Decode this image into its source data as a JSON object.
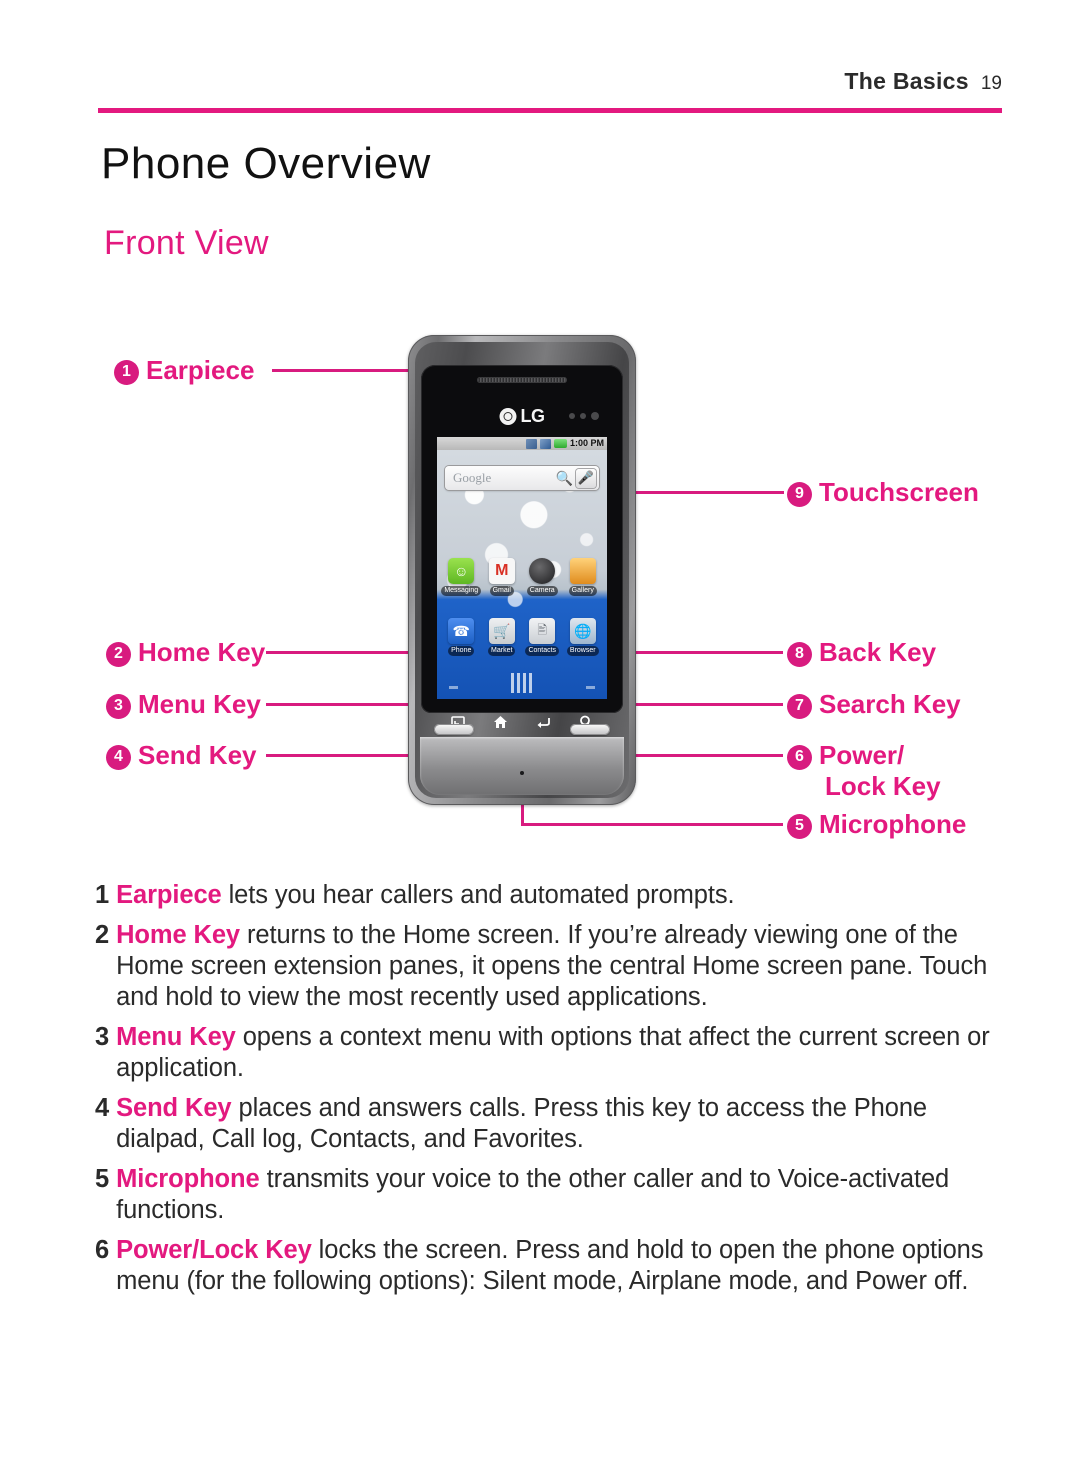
{
  "header": {
    "title": "The Basics",
    "page_number": "19",
    "rule_color": "#e3197f"
  },
  "titles": {
    "doc_title": "Phone Overview",
    "section_title": "Front View"
  },
  "callouts": [
    {
      "id": "earpiece",
      "number": "1",
      "label": "Earpiece",
      "label_line2": ""
    },
    {
      "id": "home-key",
      "number": "2",
      "label": "Home Key",
      "label_line2": ""
    },
    {
      "id": "menu-key",
      "number": "3",
      "label": "Menu Key",
      "label_line2": ""
    },
    {
      "id": "send-key",
      "number": "4",
      "label": "Send Key",
      "label_line2": ""
    },
    {
      "id": "microphone",
      "number": "5",
      "label": "Microphone",
      "label_line2": ""
    },
    {
      "id": "power-lock",
      "number": "6",
      "label": "Power/",
      "label_line2": "Lock Key"
    },
    {
      "id": "search-key",
      "number": "7",
      "label": "Search Key",
      "label_line2": ""
    },
    {
      "id": "back-key",
      "number": "8",
      "label": "Back Key",
      "label_line2": ""
    },
    {
      "id": "touchscreen",
      "number": "9",
      "label": "Touchscreen",
      "label_line2": ""
    }
  ],
  "phone": {
    "brand": "LG",
    "status_bar": {
      "time": "1:00 PM",
      "icons": [
        "usb-icon",
        "signal-bars-icon",
        "battery-icon"
      ]
    },
    "search_widget": {
      "provider": "Google",
      "search_icon": "search-icon",
      "mic_icon": "microphone-icon"
    },
    "apps_row1": [
      {
        "name": "Messaging",
        "icon": "messaging-icon",
        "glyph": "◯"
      },
      {
        "name": "Gmail",
        "icon": "gmail-icon",
        "glyph": "M"
      },
      {
        "name": "Camera",
        "icon": "camera-icon",
        "glyph": ""
      },
      {
        "name": "Gallery",
        "icon": "gallery-icon",
        "glyph": ""
      }
    ],
    "apps_row2": [
      {
        "name": "Phone",
        "icon": "phone-icon",
        "glyph": "☎"
      },
      {
        "name": "Market",
        "icon": "market-icon",
        "glyph": "▲"
      },
      {
        "name": "Contacts",
        "icon": "contacts-icon",
        "glyph": "▤"
      },
      {
        "name": "Browser",
        "icon": "browser-icon",
        "glyph": "⌖"
      }
    ],
    "hardware_keys": [
      {
        "name": "menu-key-icon",
        "label": "Menu"
      },
      {
        "name": "home-key-icon",
        "label": "Home"
      },
      {
        "name": "back-key-icon",
        "label": "Back"
      },
      {
        "name": "search-key-icon",
        "label": "Search"
      }
    ]
  },
  "descriptions": [
    {
      "number": "1",
      "term": "Earpiece",
      "text": " lets you hear callers and automated prompts."
    },
    {
      "number": "2",
      "term": "Home Key",
      "text": " returns to the Home screen. If you’re already viewing one of the Home screen extension panes, it opens the central Home screen pane. Touch and hold to view the most recently used applications."
    },
    {
      "number": "3",
      "term": "Menu Key",
      "text": " opens a context menu with options that affect the current screen or application."
    },
    {
      "number": "4",
      "term": "Send Key",
      "text": " places and answers calls. Press this key to access the Phone dialpad, Call log, Contacts, and Favorites."
    },
    {
      "number": "5",
      "term": "Microphone",
      "text": " transmits your voice to the other caller and to Voice-activated functions."
    },
    {
      "number": "6",
      "term": "Power/Lock Key",
      "text": " locks the screen. Press and hold to open the phone options menu (for the following options): Silent mode, Airplane mode, and Power off."
    }
  ]
}
